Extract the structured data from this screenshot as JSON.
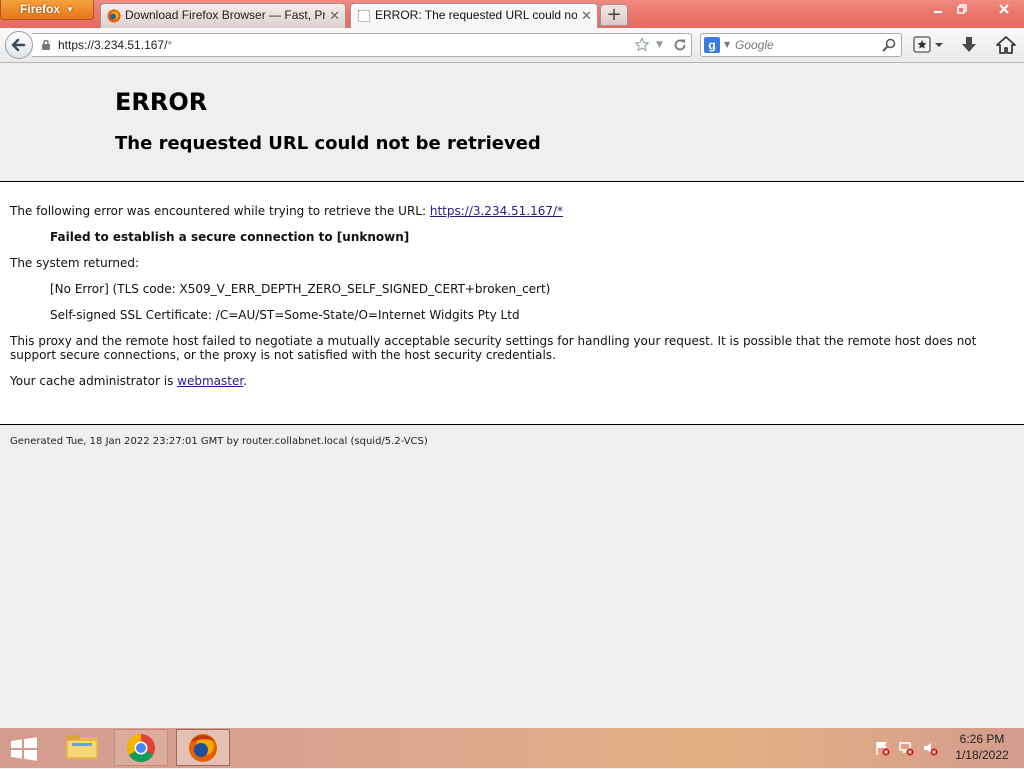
{
  "browser": {
    "menu_label": "Firefox",
    "tabs": [
      {
        "title": "Download Firefox Browser — Fast, Pri...",
        "active": false
      },
      {
        "title": "ERROR: The requested URL could not ...",
        "active": true
      }
    ],
    "url": "https://3.234.51.167/",
    "url_suffix": "*",
    "search_placeholder": "Google",
    "search_engine_letter": "g"
  },
  "page": {
    "title": "ERROR",
    "subtitle": "The requested URL could not be retrieved",
    "intro": "The following error was encountered while trying to retrieve the URL: ",
    "intro_link": "https://3.234.51.167/*",
    "failed": "Failed to establish a secure connection to [unknown]",
    "system_returned": "The system returned:",
    "tls_line": "[No Error] (TLS code: X509_V_ERR_DEPTH_ZERO_SELF_SIGNED_CERT+broken_cert)",
    "cert_line": "Self-signed SSL Certificate: /C=AU/ST=Some-State/O=Internet Widgits Pty Ltd",
    "explanation": "This proxy and the remote host failed to negotiate a mutually acceptable security settings for handling your request. It is possible that the remote host does not support secure connections, or the proxy is not satisfied with the host security credentials.",
    "admin_prefix": "Your cache administrator is ",
    "admin_link": "webmaster",
    "admin_suffix": ".",
    "footer": "Generated Tue, 18 Jan 2022 23:27:01 GMT by router.collabnet.local (squid/5.2-VCS)"
  },
  "taskbar": {
    "apps": [
      "file-explorer-icon",
      "chrome-icon",
      "firefox-icon"
    ],
    "time": "6:26 PM",
    "date": "1/18/2022"
  },
  "colors": {
    "titlebar": "#e97468",
    "firefox_button": "#f28a26",
    "link": "#2b1a8a",
    "page_bg": "#efefef",
    "content_bg": "#ffffff"
  }
}
